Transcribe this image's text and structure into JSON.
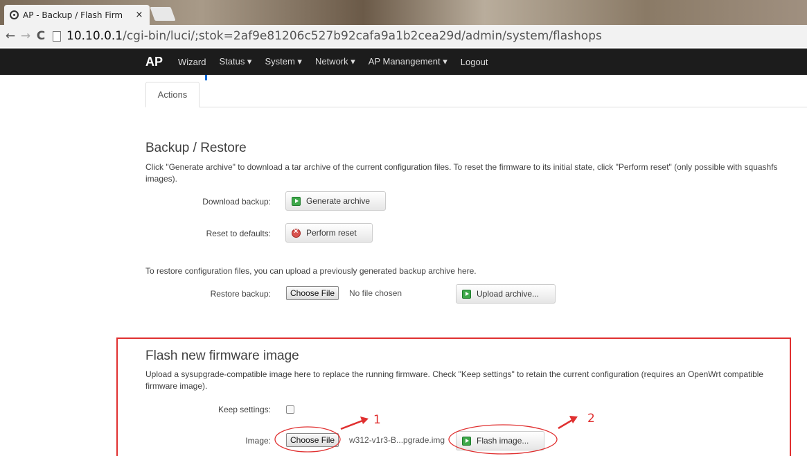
{
  "browser": {
    "tab_title": "AP - Backup / Flash Firm",
    "tab_close": "×",
    "url_host": "10.10.0.1",
    "url_path": "/cgi-bin/luci/;stok=2af9e81206c527b92cafa9a1b2cea29d/admin/system/flashops",
    "back_glyph": "←",
    "forward_glyph": "→",
    "reload_glyph": "C"
  },
  "header": {
    "brand": "AP",
    "menu": [
      "Wizard",
      "Status ▾",
      "System ▾",
      "Network ▾",
      "AP Manangement ▾",
      "Logout"
    ]
  },
  "tabs": {
    "actions": "Actions"
  },
  "backup": {
    "title": "Backup / Restore",
    "description": "Click \"Generate archive\" to download a tar archive of the current configuration files. To reset the firmware to its initial state, click \"Perform reset\" (only possible with squashfs images).",
    "download_label": "Download backup:",
    "generate_button": "Generate archive",
    "reset_label": "Reset to defaults:",
    "reset_button": "Perform reset",
    "restore_note": "To restore configuration files, you can upload a previously generated backup archive here.",
    "restore_label": "Restore backup:",
    "choose_file": "Choose File",
    "no_file": "No file chosen",
    "upload_button": "Upload archive..."
  },
  "flash": {
    "title": "Flash new firmware image",
    "description": "Upload a sysupgrade-compatible image here to replace the running firmware. Check \"Keep settings\" to retain the current configuration (requires an OpenWrt compatible firmware image).",
    "keep_label": "Keep settings:",
    "keep_checked": false,
    "image_label": "Image:",
    "choose_file": "Choose File",
    "file_name": "w312-v1r3-B...pgrade.img",
    "flash_button": "Flash image..."
  },
  "annotations": {
    "one": "1",
    "two": "2"
  },
  "colors": {
    "annotation": "#e03030",
    "header_bg": "#1c1c1c",
    "link_blue": "#0069d6"
  }
}
